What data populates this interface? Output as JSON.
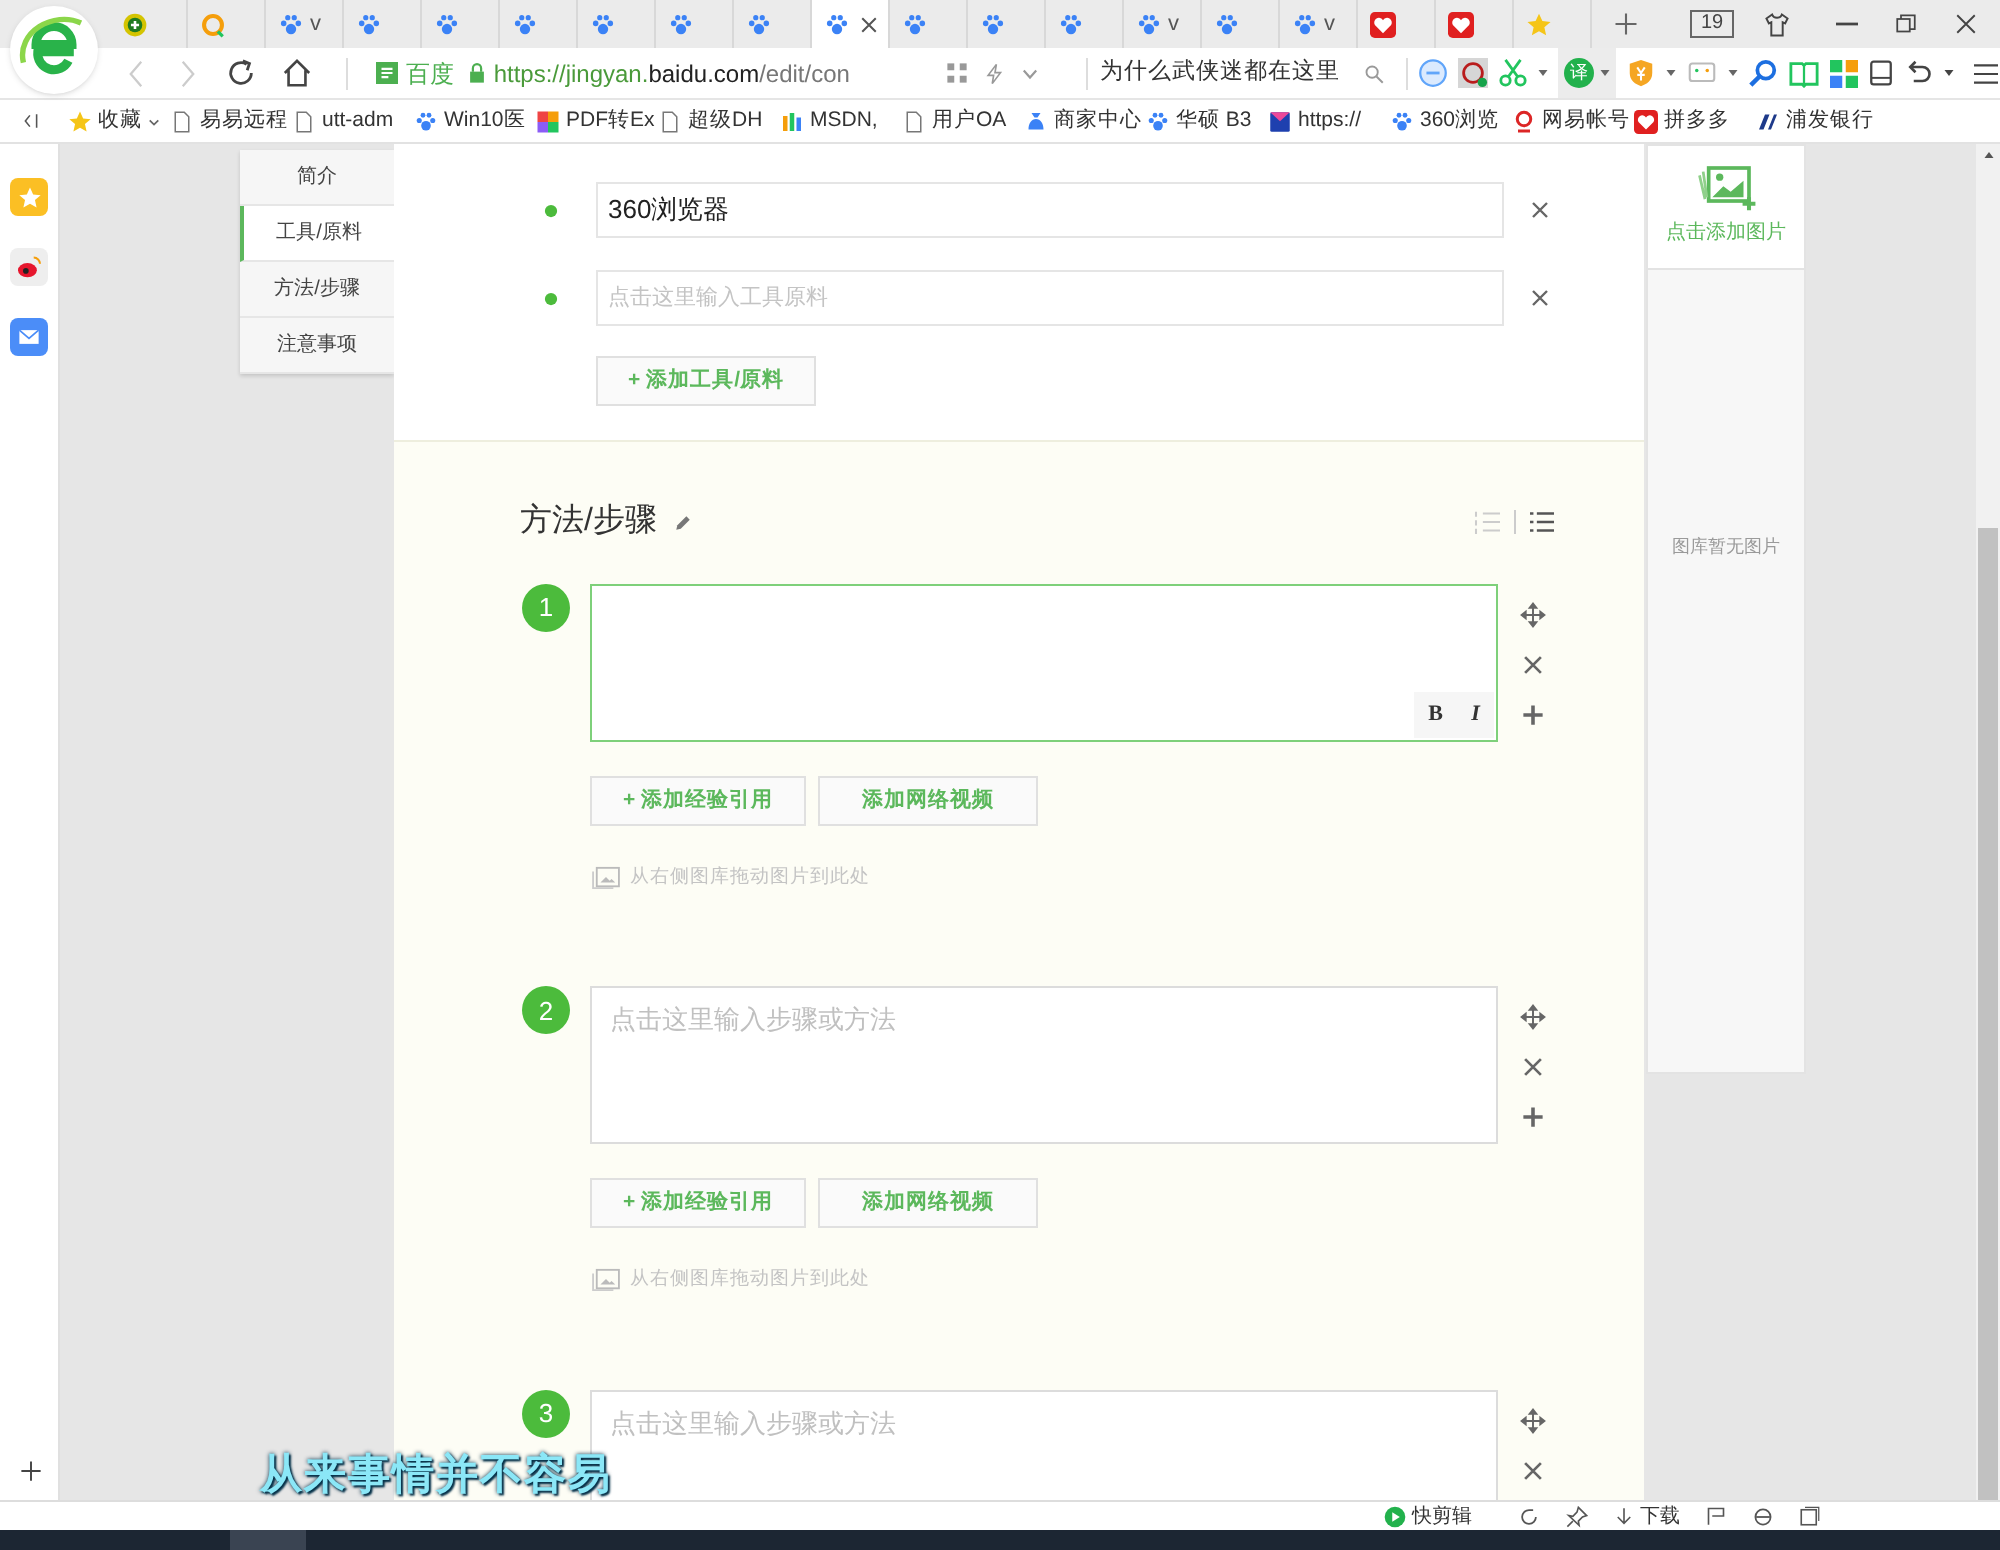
{
  "browser": {
    "tabs": [
      {
        "kind": "plus-circle",
        "selected": false
      },
      {
        "kind": "ring",
        "selected": false
      },
      {
        "kind": "paw",
        "label": "v",
        "selected": false
      },
      {
        "kind": "paw",
        "selected": false
      },
      {
        "kind": "paw",
        "selected": false
      },
      {
        "kind": "paw",
        "selected": false
      },
      {
        "kind": "paw",
        "selected": false
      },
      {
        "kind": "paw",
        "selected": false
      },
      {
        "kind": "paw",
        "selected": false
      },
      {
        "kind": "paw",
        "selected": true
      },
      {
        "kind": "paw",
        "selected": false
      },
      {
        "kind": "paw",
        "selected": false
      },
      {
        "kind": "paw",
        "selected": false
      },
      {
        "kind": "paw",
        "label": "v",
        "selected": false
      },
      {
        "kind": "paw",
        "selected": false
      },
      {
        "kind": "paw",
        "label": "v",
        "selected": false
      },
      {
        "kind": "heart",
        "selected": false
      },
      {
        "kind": "heart",
        "selected": false
      },
      {
        "kind": "star",
        "selected": false
      }
    ],
    "tab_count": "19",
    "address": {
      "site_label": "百度",
      "url_host": "https://jingyan.",
      "url_domain": "baidu.com",
      "url_path": "/edit/con"
    },
    "search": {
      "value": "为什么武侠迷都在这里"
    },
    "translate_glyph": "译",
    "bookmarks": [
      {
        "kind": "menu",
        "label": "收藏"
      },
      {
        "kind": "doc",
        "label": "易易远程"
      },
      {
        "kind": "doc",
        "label": "utt-adm"
      },
      {
        "kind": "paw",
        "label": "Win10医"
      },
      {
        "kind": "pdf",
        "label": "PDF转Ex"
      },
      {
        "kind": "doc",
        "label": "超级DH"
      },
      {
        "kind": "msdn",
        "label": "MSDN,"
      },
      {
        "kind": "doc",
        "label": "用户OA"
      },
      {
        "kind": "bag",
        "label": "商家中心"
      },
      {
        "kind": "paw",
        "label": "华硕 B3"
      },
      {
        "kind": "bluebook",
        "label": "https://"
      },
      {
        "kind": "paw",
        "label": "360浏览"
      },
      {
        "kind": "netease",
        "label": "网易帐号"
      },
      {
        "kind": "heart",
        "label": "拼多多"
      },
      {
        "kind": "bank",
        "label": "浦发银行"
      }
    ]
  },
  "nav": [
    {
      "label": "简介",
      "selected": false
    },
    {
      "label": "工具/原料",
      "selected": true
    },
    {
      "label": "方法/步骤",
      "selected": false
    },
    {
      "label": "注意事项",
      "selected": false
    }
  ],
  "tools": {
    "items": [
      {
        "value": "360浏览器"
      },
      {
        "placeholder": "点击这里输入工具原料"
      }
    ],
    "add_button": "+ 添加工具/原料"
  },
  "steps_section": {
    "title": "方法/步骤",
    "steps": [
      {
        "number": "1",
        "focused": true,
        "add_reference": "+ 添加经验引用",
        "add_video": "添加网络视频",
        "drop_hint": "从右侧图库拖动图片到此处"
      },
      {
        "number": "2",
        "placeholder": "点击这里输入步骤或方法",
        "focused": false,
        "add_reference": "+ 添加经验引用",
        "add_video": "添加网络视频",
        "drop_hint": "从右侧图库拖动图片到此处"
      },
      {
        "number": "3",
        "placeholder": "点击这里输入步骤或方法",
        "focused": false
      }
    ],
    "format_buttons": [
      "B",
      "I"
    ]
  },
  "gallery": {
    "add_label": "点击添加图片",
    "empty_text": "图库暂无图片"
  },
  "lyrics": "从来事情并不容易",
  "status_bar": {
    "clip_label": "快剪辑",
    "download_label": "下载"
  }
}
